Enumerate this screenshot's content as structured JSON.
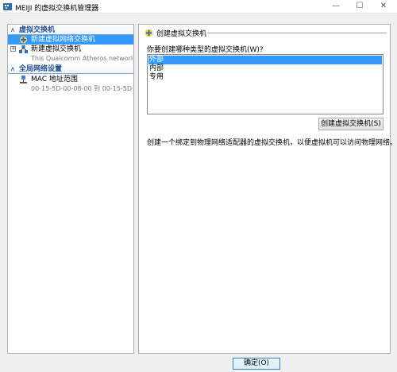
{
  "window": {
    "title": "MEIJI 的虚拟交换机管理器",
    "controls": {
      "minimize": "—",
      "maximize": "☐",
      "close": "✕"
    }
  },
  "left_pane": {
    "sections": [
      {
        "label": "虚拟交换机",
        "toggle": "∧"
      },
      {
        "label": "全局网络设置",
        "toggle": "∧"
      }
    ],
    "items": [
      {
        "label": "新建虚拟网络交换机",
        "icon": "new-switch-icon",
        "selected": true
      },
      {
        "label": "新建虚拟交换机",
        "subtitle": "This Qualcomm Atheros network C...",
        "icon": "network-switch-icon",
        "expander": "+"
      },
      {
        "label": "MAC 地址范围",
        "subtitle": "00-15-5D-00-08-00 到 00-15-5D-0...",
        "icon": "mac-address-icon"
      }
    ]
  },
  "right_pane": {
    "header": "创建虚拟交换机",
    "question": "你要创建哪种类型的虚拟交换机(W)?",
    "switch_types": [
      "外部",
      "内部",
      "专用"
    ],
    "selected_type": "外部",
    "create_button": "创建虚拟交换机(S)",
    "description": "创建一个绑定到物理网络适配器的虚拟交换机，以便虚拟机可以访问物理网络。"
  },
  "footer": {
    "ok_button": "确定(O)"
  },
  "colors": {
    "selection": "#3399ff",
    "section_text": "#1f4f8f",
    "section_rule": "#7ea6d8"
  }
}
